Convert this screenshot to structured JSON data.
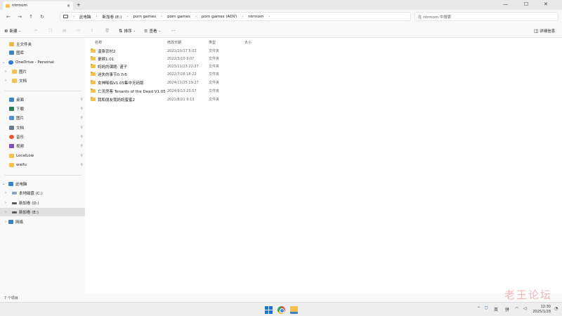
{
  "window": {
    "tab_title": "ntrmom",
    "tab_close": "×",
    "new_tab": "+",
    "minimize": "—",
    "maximize": "☐",
    "close": "✕"
  },
  "nav": {
    "back": "←",
    "forward": "→",
    "up": "↑",
    "refresh": "↻",
    "breadcrumb": [
      "此电脑",
      "新加卷 (E:)",
      "porn games",
      "porn games",
      "porn games (ADV)",
      "ntrmom"
    ],
    "separator": "›",
    "search_placeholder": "在 ntrmom 中搜索"
  },
  "toolbar": {
    "new_label": "新建",
    "sort_label": "排序",
    "view_label": "查看",
    "more_label": "···",
    "details_label": "详细信息"
  },
  "sidebar": {
    "quick": [
      {
        "label": "主文件夹",
        "color": "#e9b949"
      },
      {
        "label": "图库",
        "color": "#3b82c4"
      }
    ],
    "onedrive": {
      "label": "OneDrive - Personal"
    },
    "onedrive_children": [
      {
        "label": "图片",
        "color": "#f2c14e"
      },
      {
        "label": "文档",
        "color": "#f2c14e"
      }
    ],
    "pinned": [
      {
        "label": "桌面",
        "color": "#3b82c4"
      },
      {
        "label": "下载",
        "color": "#2a7d4f"
      },
      {
        "label": "图片",
        "color": "#4a90d9"
      },
      {
        "label": "文档",
        "color": "#6b7b8c"
      },
      {
        "label": "音乐",
        "color": "#e4572e"
      },
      {
        "label": "视频",
        "color": "#7b4fbf"
      },
      {
        "label": "LocalLow",
        "color": "#f2c14e"
      },
      {
        "label": "waifu",
        "color": "#f2c14e"
      }
    ],
    "pc": {
      "label": "此电脑"
    },
    "drives": [
      {
        "label": "本地磁盘 (C:)"
      },
      {
        "label": "新加卷 (D:)"
      },
      {
        "label": "新加卷 (E:)"
      }
    ],
    "network": {
      "label": "网络"
    },
    "pin_glyph": "📌"
  },
  "columns": {
    "name": "名称",
    "date": "修改日期",
    "type": "类型",
    "size": "大小"
  },
  "files": [
    {
      "name": "温泉农村2",
      "date": "2021/10/17 5:02",
      "type": "文件夹"
    },
    {
      "name": "妻嫁1.01",
      "date": "2022/3/10 9:07",
      "type": "文件夹"
    },
    {
      "name": "妈妈的课题: 谨子",
      "date": "2023/11/23 22:27",
      "type": "文件夹"
    },
    {
      "name": "迷失的事节0.7r5",
      "date": "2022/7/28 18:22",
      "type": "文件夹"
    },
    {
      "name": "女神降临V1.05集中无码版",
      "date": "2024/11/25 19:27",
      "type": "文件夹"
    },
    {
      "name": "亡灵房客 Tenants of the Dead V1.05",
      "date": "2024/9/13 23:57",
      "type": "文件夹"
    },
    {
      "name": "我和朋友我妈妈蜜蜜2",
      "date": "2021/8/21 9:13",
      "type": "文件夹"
    }
  ],
  "status": {
    "item_count": "7 个项目"
  },
  "taskbar": {
    "ime": "英",
    "ime2": "拼",
    "time": "12:30",
    "date": "2025/1/28"
  },
  "watermark": "老王论坛"
}
